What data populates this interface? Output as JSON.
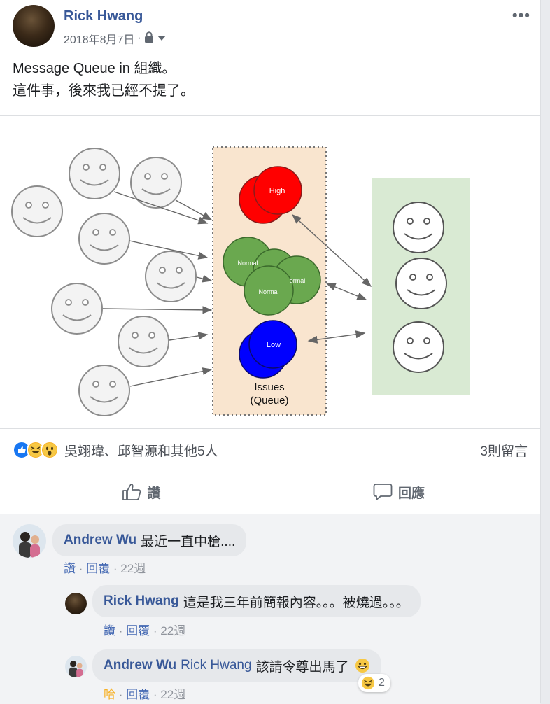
{
  "post": {
    "author": "Rick Hwang",
    "date": "2018年8月7日",
    "separator": "·",
    "privacy_icon": "lock-icon",
    "line1": "Message Queue in 組織。",
    "line2": "這件事，後來我已經不提了。"
  },
  "figure": {
    "queue_label_1": "Issues",
    "queue_label_2": "(Queue)",
    "high": "High",
    "normal_1": "Normal",
    "normal_2": "ormal",
    "normal_3": "Normal",
    "low": "Low"
  },
  "reactions": {
    "names": "吳翊瑋、邱智源和其他5人",
    "comment_count": "3則留言"
  },
  "actions": {
    "like": "讚",
    "comment": "回應"
  },
  "comments": [
    {
      "author": "Andrew Wu",
      "text": "最近一直中槍....",
      "like": "讚",
      "reply": "回覆",
      "sep": "·",
      "time": "22週"
    },
    {
      "author": "Rick Hwang",
      "text": "這是我三年前簡報內容。。。被燒過。。。",
      "like": "讚",
      "reply": "回覆",
      "sep": "·",
      "time": "22週"
    },
    {
      "author": "Andrew Wu",
      "tag": "Rick Hwang",
      "text": "該請令尊出馬了",
      "like": "哈",
      "reply": "回覆",
      "sep": "·",
      "time": "22週",
      "reaction_count": "2"
    }
  ],
  "colors": {
    "link": "#385898",
    "queue_bg": "#f9e5cf",
    "workers_bg": "#d9ead3",
    "high": "#ff0000",
    "normal": "#6aa84f",
    "low": "#0000ff"
  }
}
